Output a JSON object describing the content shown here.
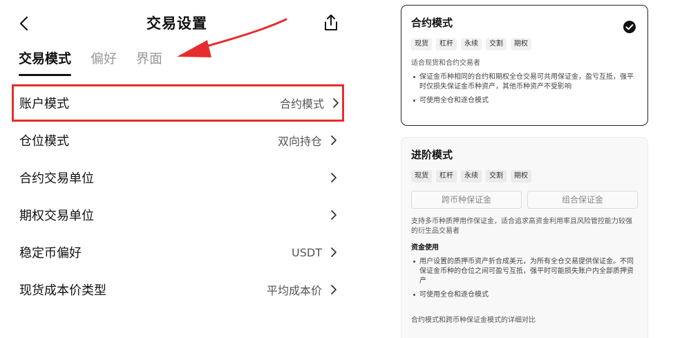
{
  "header": {
    "title": "交易设置"
  },
  "tabs": [
    {
      "label": "交易模式",
      "active": true
    },
    {
      "label": "偏好",
      "active": false
    },
    {
      "label": "界面",
      "active": false
    }
  ],
  "rows": [
    {
      "label": "账户模式",
      "value": "合约模式"
    },
    {
      "label": "仓位模式",
      "value": "双向持仓"
    },
    {
      "label": "合约交易单位",
      "value": ""
    },
    {
      "label": "期权交易单位",
      "value": ""
    },
    {
      "label": "稳定币偏好",
      "value": "USDT"
    },
    {
      "label": "现货成本价类型",
      "value": "平均成本价"
    }
  ],
  "cards": {
    "contract": {
      "title": "合约模式",
      "chips": [
        "现货",
        "杠杆",
        "永续",
        "交割",
        "期权"
      ],
      "desc": "适合现货和合约交易者",
      "bullets": [
        "保证金币种相同的合约和期权全仓交易可共用保证金，盈亏互抵，强平时仅损失保证金币种资产，其他币种资产不受影响",
        "可使用全仓和逐仓模式"
      ]
    },
    "advanced": {
      "title": "进阶模式",
      "chips": [
        "现货",
        "杠杆",
        "永续",
        "交割",
        "期权"
      ],
      "sub_buttons": [
        "跨币种保证金",
        "组合保证金"
      ],
      "desc": "支持多币种质押用作保证金，适合追求高资金利用率且风险管控能力较强的衍生品交易者",
      "section_title": "资金使用",
      "bullets": [
        "用户设置的质押币资产折合成美元，为所有全仓交易提供保证金。不同保证金币种的仓位之间可盈亏互抵，强平时可能损失账户内全部质押资产",
        "可使用全仓和逐仓模式"
      ],
      "footnote": "合约模式和跨币种保证金模式的详细对比"
    }
  },
  "colors": {
    "highlight": "#e52d2d",
    "arrow": "#e52d2d"
  }
}
